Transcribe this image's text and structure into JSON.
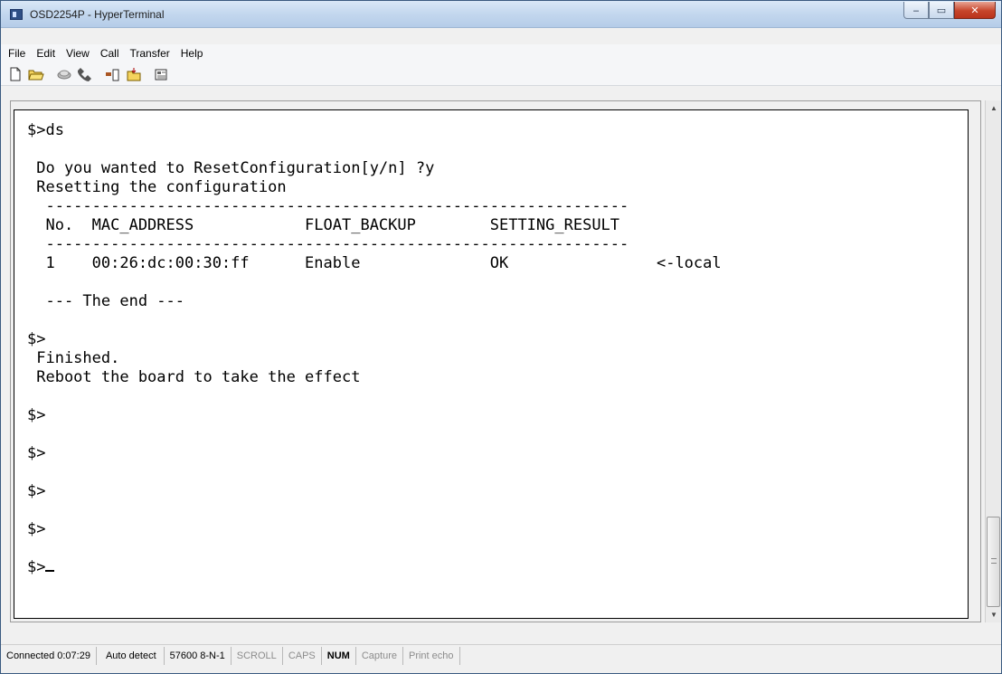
{
  "window": {
    "title": "OSD2254P - HyperTerminal",
    "minimize_glyph": "‒",
    "maximize_glyph": "▭",
    "close_glyph": "✕"
  },
  "menu": [
    "File",
    "Edit",
    "View",
    "Call",
    "Transfer",
    "Help"
  ],
  "toolbar": {
    "icons": [
      "new-icon",
      "open-icon",
      "disconnect-icon",
      "call-icon",
      "send-icon",
      "receive-icon",
      "properties-icon"
    ]
  },
  "terminal": {
    "lines": [
      "$>ds",
      "",
      " Do you wanted to ResetConfiguration[y/n] ?y",
      " Resetting the configuration",
      "  ---------------------------------------------------------------",
      "  No.  MAC_ADDRESS            FLOAT_BACKUP        SETTING_RESULT",
      "  ---------------------------------------------------------------",
      "  1    00:26:dc:00:30:ff      Enable              OK                <-local",
      "",
      "  --- The end ---",
      "",
      "$>",
      " Finished.",
      " Reboot the board to take the effect",
      "",
      "$>",
      "",
      "$>",
      "",
      "$>",
      "",
      "$>",
      "",
      "$>"
    ]
  },
  "statusbar": {
    "connected": "Connected 0:07:29",
    "detect": "Auto detect",
    "port": "57600 8-N-1",
    "scroll": "SCROLL",
    "caps": "CAPS",
    "num": "NUM",
    "capture": "Capture",
    "print_echo": "Print echo"
  }
}
